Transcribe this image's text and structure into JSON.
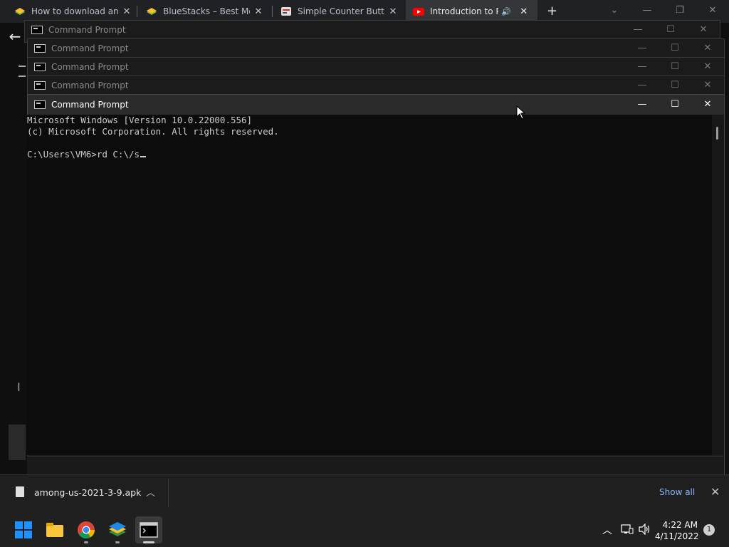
{
  "browser": {
    "tabs": [
      {
        "title": "How to download and i",
        "favicon": "bluestacks-icon",
        "active": false
      },
      {
        "title": "BlueStacks – Best Mobil",
        "favicon": "bluestacks-icon",
        "active": false
      },
      {
        "title": "Simple Counter Button",
        "favicon": "pen-icon",
        "active": false
      },
      {
        "title": "Introduction to Pro",
        "favicon": "youtube-icon",
        "active": true
      }
    ],
    "new_tab_label": "+",
    "back_symbol": "←"
  },
  "cmd_windows": {
    "title": "Command Prompt",
    "count": 5
  },
  "console": {
    "lines": [
      "Microsoft Windows [Version 10.0.22000.556]",
      "(c) Microsoft Corporation. All rights reserved.",
      "",
      "C:\\Users\\VM6>rd C:\\/s"
    ]
  },
  "downloads": {
    "filename": "among-us-2021-3-9.apk",
    "show_all": "Show all"
  },
  "taskbar": {
    "time": "4:22 AM",
    "date": "4/11/2022",
    "notification_count": "1"
  },
  "colors": {
    "accent_link": "#8ab4f8",
    "youtube_red": "#ff0000",
    "windows_blue": "#1e90ff"
  }
}
